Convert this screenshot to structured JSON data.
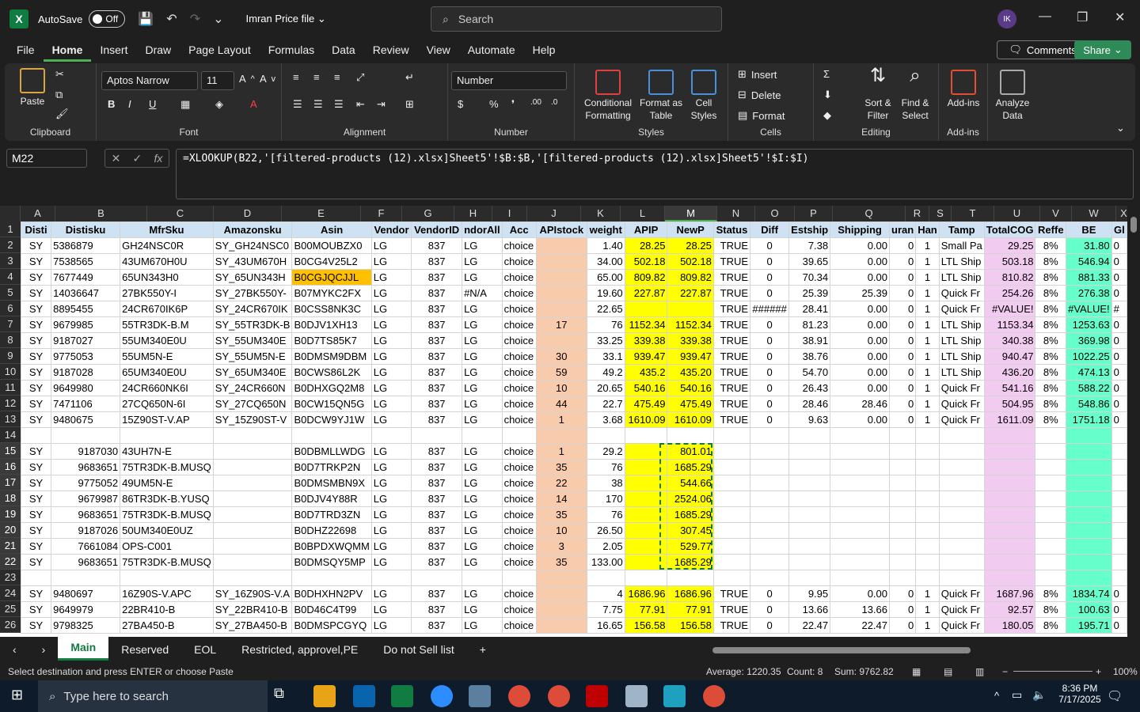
{
  "app": {
    "autosave": "AutoSave",
    "autosave_state": "Off",
    "file_name": "Imran Price file",
    "search_placeholder": "Search",
    "avatar": "IK"
  },
  "menu": [
    "File",
    "Home",
    "Insert",
    "Draw",
    "Page Layout",
    "Formulas",
    "Data",
    "Review",
    "View",
    "Automate",
    "Help"
  ],
  "actions": {
    "comments": "Comments",
    "share": "Share"
  },
  "ribbon": {
    "clipboard": {
      "paste": "Paste",
      "label": "Clipboard"
    },
    "font": {
      "name": "Aptos Narrow",
      "size": "11",
      "label": "Font"
    },
    "alignment": {
      "label": "Alignment"
    },
    "number": {
      "format": "Number",
      "label": "Number"
    },
    "styles": {
      "cond": "Conditional Formatting",
      "format_table": "Format as Table",
      "cell_styles": "Cell Styles",
      "label": "Styles"
    },
    "cells": {
      "insert": "Insert",
      "delete": "Delete",
      "format": "Format",
      "label": "Cells"
    },
    "editing": {
      "sort": "Sort & Filter",
      "find": "Find & Select",
      "label": "Editing"
    },
    "addins": {
      "addins": "Add-ins",
      "label": "Add-ins"
    },
    "analyze": {
      "label": "Analyze Data"
    }
  },
  "formula_bar": {
    "name_box": "M22",
    "formula": "=XLOOKUP(B22,'[filtered-products (12).xlsx]Sheet5'!$B:$B,'[filtered-products (12).xlsx]Sheet5'!$I:$I)"
  },
  "columns": [
    "A",
    "B",
    "C",
    "D",
    "E",
    "F",
    "G",
    "H",
    "I",
    "J",
    "K",
    "L",
    "M",
    "N",
    "O",
    "P",
    "Q",
    "R",
    "S",
    "T",
    "U",
    "V",
    "W",
    "X"
  ],
  "header_row": [
    "Disti",
    "Distisku",
    "MfrSku",
    "Amazonsku",
    "Asin",
    "Vendor",
    "VendorID",
    "ndorAll",
    "Acc",
    "APIstock",
    "weight",
    "APIP",
    "NewP",
    "Status",
    "Diff",
    "Estship",
    "Shipping",
    "uran",
    "Han",
    "Tamp",
    "TotalCOG",
    "Reffe",
    "BE",
    "Gl"
  ],
  "rows": [
    [
      "2",
      "SY",
      "5386879",
      "GH24NSC0R",
      "SY_GH24NSC0",
      "B00MOUBZX0",
      "LG",
      "837",
      "LG",
      "choice",
      "",
      "1.40",
      "28.25",
      "28.25",
      "TRUE",
      "0",
      "7.38",
      "0.00",
      "0",
      "1",
      "Small Pa",
      "29.25",
      "8%",
      "31.80",
      "0"
    ],
    [
      "3",
      "SY",
      "7538565",
      "43UM670H0U",
      "SY_43UM670H",
      "B0CG4V25L2",
      "LG",
      "837",
      "LG",
      "choice",
      "",
      "34.00",
      "502.18",
      "502.18",
      "TRUE",
      "0",
      "39.65",
      "0.00",
      "0",
      "1",
      "LTL Ship",
      "503.18",
      "8%",
      "546.94",
      "0"
    ],
    [
      "4",
      "SY",
      "7677449",
      "65UN343H0",
      "SY_65UN343H",
      "B0CGJQCJJL",
      "LG",
      "837",
      "LG",
      "choice",
      "",
      "65.00",
      "809.82",
      "809.82",
      "TRUE",
      "0",
      "70.34",
      "0.00",
      "0",
      "1",
      "LTL Ship",
      "810.82",
      "8%",
      "881.33",
      "0"
    ],
    [
      "5",
      "SY",
      "14036647",
      "27BK550Y-I",
      "SY_27BK550Y-",
      "B07MYKC2FX",
      "LG",
      "837",
      "#N/A",
      "choice",
      "",
      "19.60",
      "227.87",
      "227.87",
      "TRUE",
      "0",
      "25.39",
      "25.39",
      "0",
      "1",
      "Quick Fr",
      "254.26",
      "8%",
      "276.38",
      "0"
    ],
    [
      "6",
      "SY",
      "8895455",
      "24CR670IK6P",
      "SY_24CR670IK",
      "B0CSS8NK3C",
      "LG",
      "837",
      "LG",
      "choice",
      "",
      "22.65",
      "",
      "",
      "TRUE",
      "######",
      "28.41",
      "0.00",
      "0",
      "1",
      "Quick Fr",
      "#VALUE!",
      "8%",
      "#VALUE!",
      "#"
    ],
    [
      "7",
      "SY",
      "9679985",
      "55TR3DK-B.M",
      "SY_55TR3DK-B",
      "B0DJV1XH13",
      "LG",
      "837",
      "LG",
      "choice",
      "17",
      "76",
      "1152.34",
      "1152.34",
      "TRUE",
      "0",
      "81.23",
      "0.00",
      "0",
      "1",
      "LTL Ship",
      "1153.34",
      "8%",
      "1253.63",
      "0"
    ],
    [
      "8",
      "SY",
      "9187027",
      "55UM340E0U",
      "SY_55UM340E",
      "B0D7TS85K7",
      "LG",
      "837",
      "LG",
      "choice",
      "",
      "33.25",
      "339.38",
      "339.38",
      "TRUE",
      "0",
      "38.91",
      "0.00",
      "0",
      "1",
      "LTL Ship",
      "340.38",
      "8%",
      "369.98",
      "0"
    ],
    [
      "9",
      "SY",
      "9775053",
      "55UM5N-E",
      "SY_55UM5N-E",
      "B0DMSM9DBM",
      "LG",
      "837",
      "LG",
      "choice",
      "30",
      "33.1",
      "939.47",
      "939.47",
      "TRUE",
      "0",
      "38.76",
      "0.00",
      "0",
      "1",
      "LTL Ship",
      "940.47",
      "8%",
      "1022.25",
      "0"
    ],
    [
      "10",
      "SY",
      "9187028",
      "65UM340E0U",
      "SY_65UM340E",
      "B0CWS86L2K",
      "LG",
      "837",
      "LG",
      "choice",
      "59",
      "49.2",
      "435.2",
      "435.20",
      "TRUE",
      "0",
      "54.70",
      "0.00",
      "0",
      "1",
      "LTL Ship",
      "436.20",
      "8%",
      "474.13",
      "0"
    ],
    [
      "11",
      "SY",
      "9649980",
      "24CR660NK6I",
      "SY_24CR660N",
      "B0DHXGQ2M8",
      "LG",
      "837",
      "LG",
      "choice",
      "10",
      "20.65",
      "540.16",
      "540.16",
      "TRUE",
      "0",
      "26.43",
      "0.00",
      "0",
      "1",
      "Quick Fr",
      "541.16",
      "8%",
      "588.22",
      "0"
    ],
    [
      "12",
      "SY",
      "7471106",
      "27CQ650N-6I",
      "SY_27CQ650N",
      "B0CW15QN5G",
      "LG",
      "837",
      "LG",
      "choice",
      "44",
      "22.7",
      "475.49",
      "475.49",
      "TRUE",
      "0",
      "28.46",
      "28.46",
      "0",
      "1",
      "Quick Fr",
      "504.95",
      "8%",
      "548.86",
      "0"
    ],
    [
      "13",
      "SY",
      "9480675",
      "15Z90ST-V.AP",
      "SY_15Z90ST-V",
      "B0DCW9YJ1W",
      "LG",
      "837",
      "LG",
      "choice",
      "1",
      "3.68",
      "1610.09",
      "1610.09",
      "TRUE",
      "0",
      "9.63",
      "0.00",
      "0",
      "1",
      "Quick Fr",
      "1611.09",
      "8%",
      "1751.18",
      "0"
    ],
    [
      "14",
      "",
      "",
      "",
      "",
      "",
      "",
      "",
      "",
      "",
      "",
      "",
      "",
      "",
      "",
      "",
      "",
      "",
      "",
      "",
      "",
      "",
      "",
      "",
      ""
    ],
    [
      "15",
      "SY",
      "9187030",
      "43UH7N-E",
      "",
      "B0DBMLLWDG",
      "LG",
      "837",
      "LG",
      "choice",
      "1",
      "29.2",
      "",
      "801.01",
      "",
      "",
      "",
      "",
      "",
      "",
      "",
      "",
      "",
      "",
      ""
    ],
    [
      "16",
      "SY",
      "9683651",
      "75TR3DK-B.MUSQ",
      "",
      "B0D7TRKP2N",
      "LG",
      "837",
      "LG",
      "choice",
      "35",
      "76",
      "",
      "1685.29",
      "",
      "",
      "",
      "",
      "",
      "",
      "",
      "",
      "",
      "",
      ""
    ],
    [
      "17",
      "SY",
      "9775052",
      "49UM5N-E",
      "",
      "B0DMSMBN9X",
      "LG",
      "837",
      "LG",
      "choice",
      "22",
      "38",
      "",
      "544.66",
      "",
      "",
      "",
      "",
      "",
      "",
      "",
      "",
      "",
      "",
      ""
    ],
    [
      "18",
      "SY",
      "9679987",
      "86TR3DK-B.YUSQ",
      "",
      "B0DJV4Y88R",
      "LG",
      "837",
      "LG",
      "choice",
      "14",
      "170",
      "",
      "2524.06",
      "",
      "",
      "",
      "",
      "",
      "",
      "",
      "",
      "",
      "",
      ""
    ],
    [
      "19",
      "SY",
      "9683651",
      "75TR3DK-B.MUSQ",
      "",
      "B0D7TRD3ZN",
      "LG",
      "837",
      "LG",
      "choice",
      "35",
      "76",
      "",
      "1685.29",
      "",
      "",
      "",
      "",
      "",
      "",
      "",
      "",
      "",
      "",
      ""
    ],
    [
      "20",
      "SY",
      "9187026",
      "50UM340E0UZ",
      "",
      "B0DHZ22698",
      "LG",
      "837",
      "LG",
      "choice",
      "10",
      "26.50",
      "",
      "307.45",
      "",
      "",
      "",
      "",
      "",
      "",
      "",
      "",
      "",
      "",
      ""
    ],
    [
      "21",
      "SY",
      "7661084",
      "OPS-C001",
      "",
      "B0BPDXWQMM",
      "LG",
      "837",
      "LG",
      "choice",
      "3",
      "2.05",
      "",
      "529.77",
      "",
      "",
      "",
      "",
      "",
      "",
      "",
      "",
      "",
      "",
      ""
    ],
    [
      "22",
      "SY",
      "9683651",
      "75TR3DK-B.MUSQ",
      "",
      "B0DMSQY5MP",
      "LG",
      "837",
      "LG",
      "choice",
      "35",
      "133.00",
      "",
      "1685.29",
      "",
      "",
      "",
      "",
      "",
      "",
      "",
      "",
      "",
      "",
      ""
    ],
    [
      "23",
      "",
      "",
      "",
      "",
      "",
      "",
      "",
      "",
      "",
      "",
      "",
      "",
      "",
      "",
      "",
      "",
      "",
      "",
      "",
      "",
      "",
      "",
      "",
      ""
    ],
    [
      "24",
      "SY",
      "9480697",
      "16Z90S-V.APC",
      "SY_16Z90S-V.A",
      "B0DHXHN2PV",
      "LG",
      "837",
      "LG",
      "choice",
      "",
      "4",
      "1686.96",
      "1686.96",
      "TRUE",
      "0",
      "9.95",
      "0.00",
      "0",
      "1",
      "Quick Fr",
      "1687.96",
      "8%",
      "1834.74",
      "0"
    ],
    [
      "25",
      "SY",
      "9649979",
      "22BR410-B",
      "SY_22BR410-B",
      "B0D46C4T99",
      "LG",
      "837",
      "LG",
      "choice",
      "",
      "7.75",
      "77.91",
      "77.91",
      "TRUE",
      "0",
      "13.66",
      "13.66",
      "0",
      "1",
      "Quick Fr",
      "92.57",
      "8%",
      "100.63",
      "0"
    ],
    [
      "26",
      "SY",
      "9798325",
      "27BA450-B",
      "SY_27BA450-B",
      "B0DMSPCGYQ",
      "LG",
      "837",
      "LG",
      "choice",
      "",
      "16.65",
      "156.58",
      "156.58",
      "TRUE",
      "0",
      "22.47",
      "22.47",
      "0",
      "1",
      "Quick Fr",
      "180.05",
      "8%",
      "195.71",
      "0"
    ]
  ],
  "sheet_tabs": [
    "Main",
    "Reserved",
    "EOL",
    "Restricted, approvel,PE",
    "Do not Sell list"
  ],
  "status": {
    "message": "Select destination and press ENTER or choose Paste",
    "average": "Average: 1220.35",
    "count": "Count: 8",
    "sum": "Sum: 9762.82",
    "zoom": "100%"
  },
  "taskbar": {
    "search": "Type here to search",
    "time": "8:36 PM",
    "date": "7/17/2025"
  }
}
